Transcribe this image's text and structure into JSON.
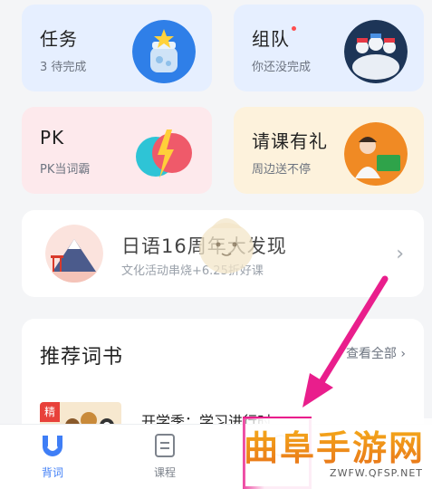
{
  "cards": {
    "task": {
      "title": "任务",
      "subtitle": "3 待完成"
    },
    "team": {
      "title": "组队",
      "subtitle": "你还没完成"
    },
    "pk": {
      "title": "PK",
      "subtitle": "PK当词霸"
    },
    "gift": {
      "title": "请课有礼",
      "subtitle": "周边送不停"
    }
  },
  "banner": {
    "title": "日语16周年大发现",
    "subtitle": "文化活动串烧+6.25折好课"
  },
  "recommend": {
    "title": "推荐词书",
    "view_all": "查看全部",
    "book": {
      "badge": "精",
      "title": "开学季：学习进行时"
    }
  },
  "tabbar": {
    "items": [
      {
        "label": "背词",
        "active": true
      },
      {
        "label": "课程",
        "active": false
      },
      {
        "label": "",
        "active": false
      }
    ]
  },
  "watermark": {
    "text": "曲阜手游网",
    "url": "ZWFW.QFSP.NET"
  },
  "colors": {
    "accent": "#3f7ef6",
    "highlight": "#e91e8c",
    "task_bg": "#e6efff",
    "pk_bg": "#fde9ec",
    "gift_bg": "#fdf2dc"
  }
}
